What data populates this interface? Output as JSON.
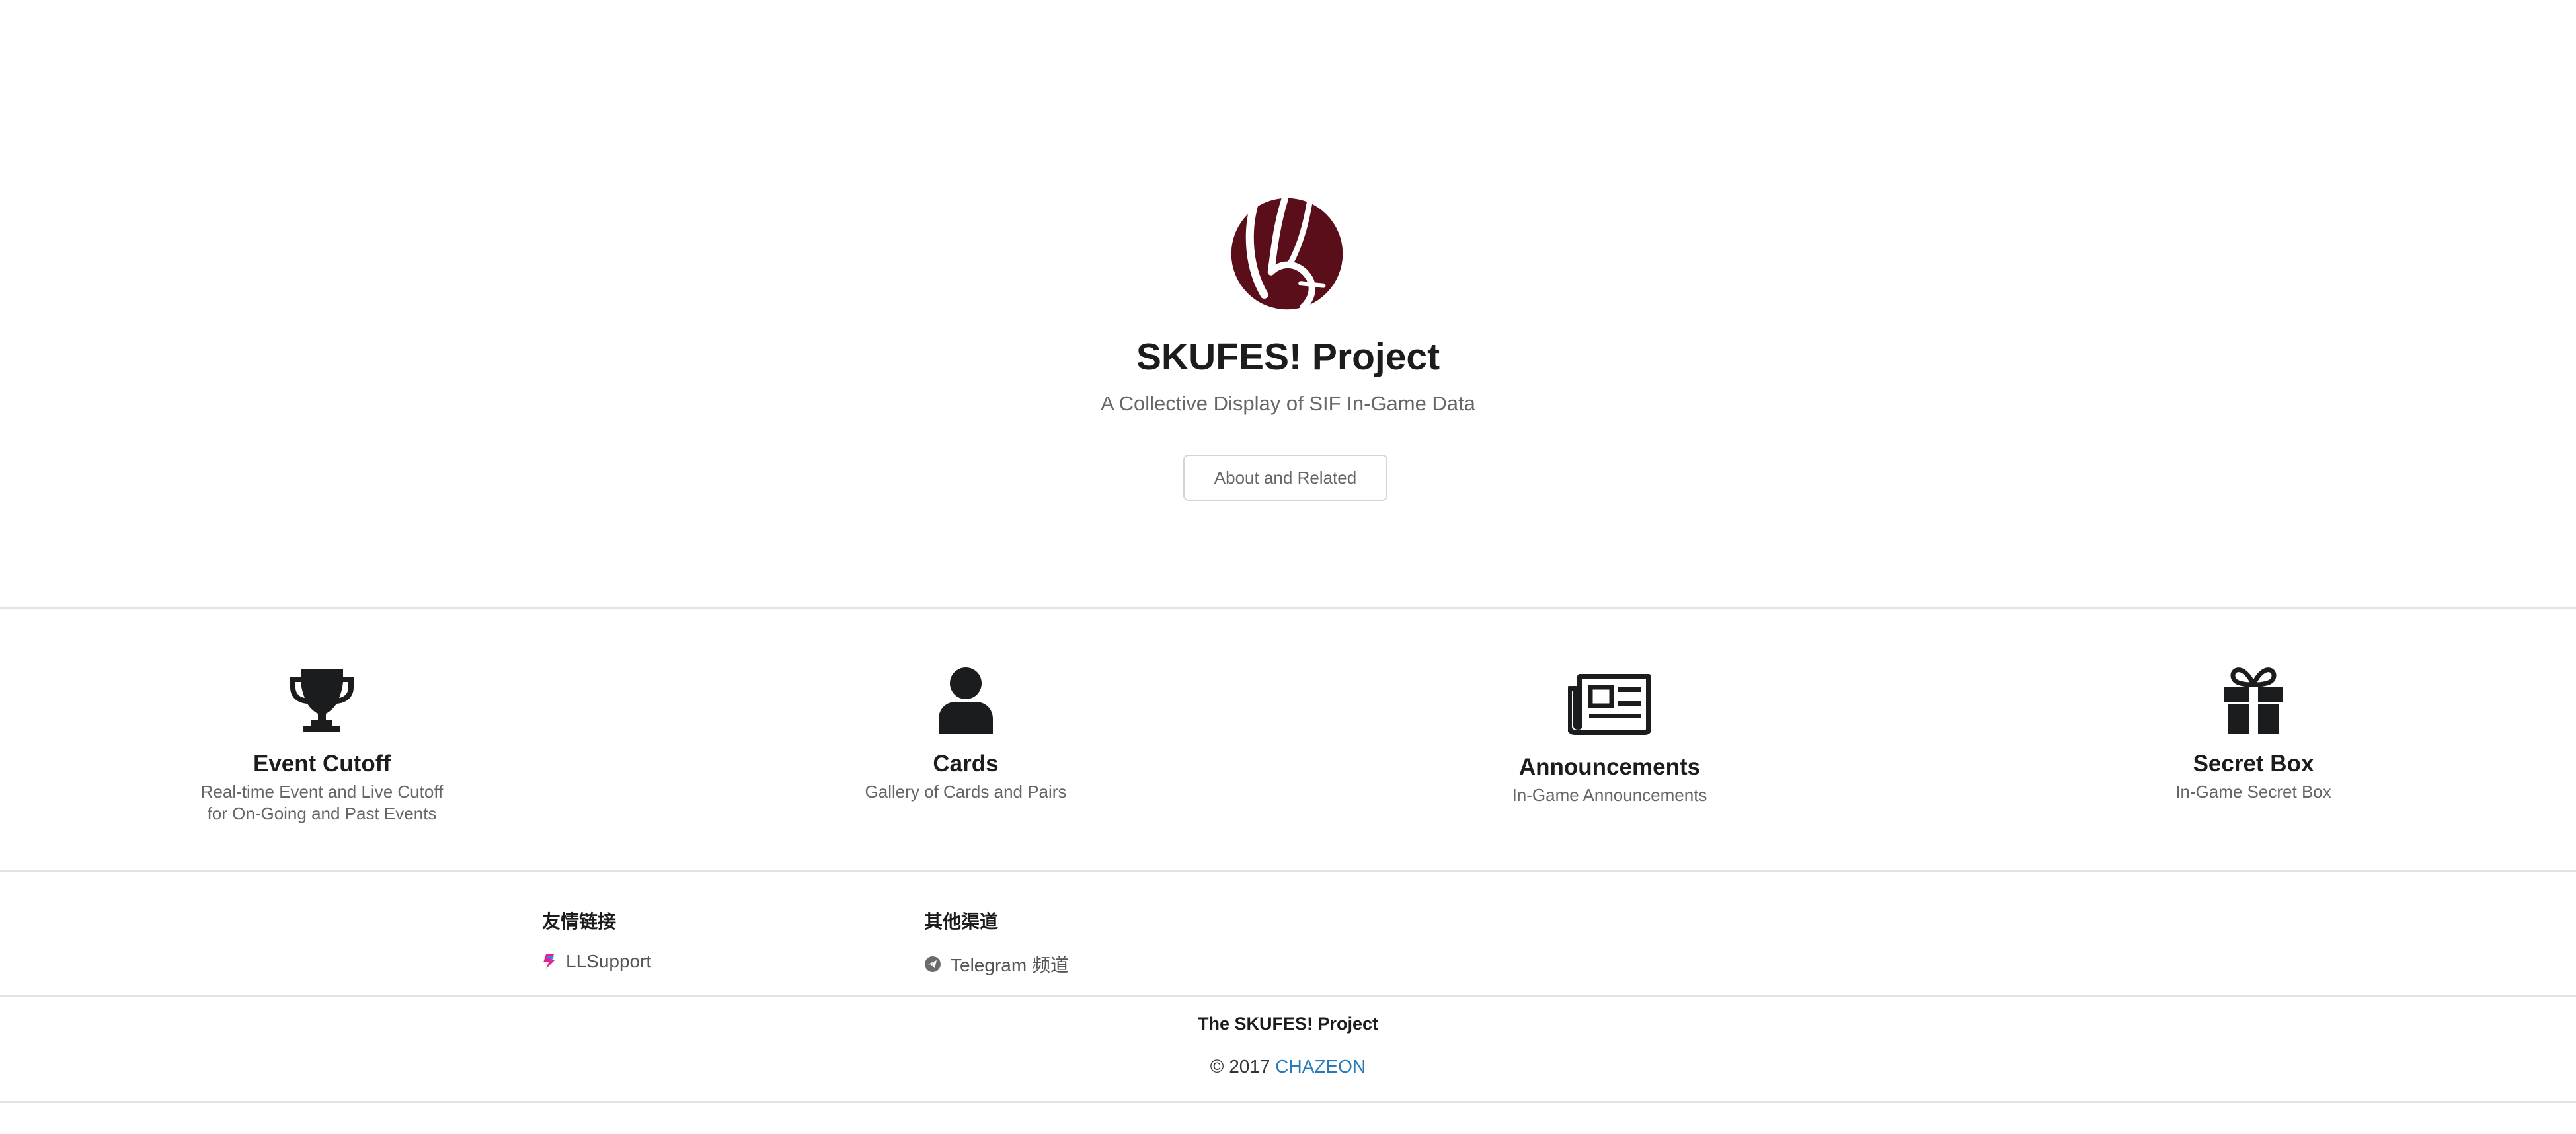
{
  "hero": {
    "title": "SKUFES! Project",
    "subtitle": "A Collective Display of SIF In-Game Data",
    "about_button": "About and Related",
    "logo_icon": "skufes-logo-icon",
    "logo_color": "#5a0e1a"
  },
  "features": [
    {
      "icon": "trophy-icon",
      "title": "Event Cutoff",
      "desc_line1": "Real-time Event and Live Cutoff",
      "desc_line2": "for On-Going and Past Events"
    },
    {
      "icon": "user-icon",
      "title": "Cards",
      "desc_line1": "Gallery of Cards and Pairs"
    },
    {
      "icon": "newspaper-icon",
      "title": "Announcements",
      "desc_line1": "In-Game Announcements"
    },
    {
      "icon": "gift-icon",
      "title": "Secret Box",
      "desc_line1": "In-Game Secret Box"
    }
  ],
  "links": {
    "friends_heading": "友情链接",
    "friends_item": "LLSupport",
    "channels_heading": "其他渠道",
    "channels_item": "Telegram 频道"
  },
  "footer": {
    "title": "The SKUFES! Project",
    "copyright": "© 2017",
    "author": "CHAZEON",
    "link_color": "#2a7ab8"
  }
}
